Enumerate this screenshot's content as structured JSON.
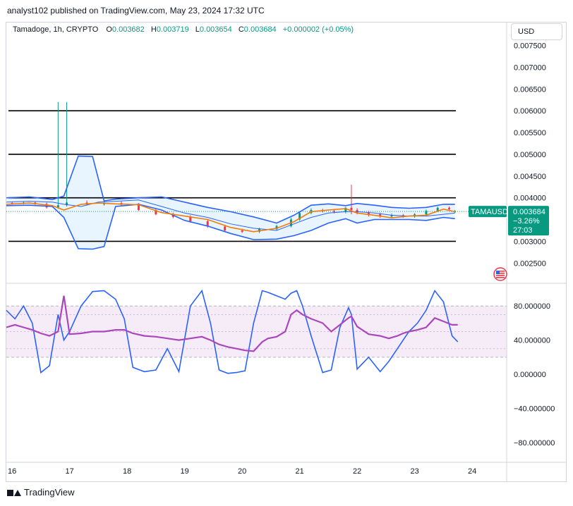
{
  "header": {
    "publish_line": "analyst102 published on TradingView.com, May 23, 2024 17:32 UTC"
  },
  "legend": {
    "symbol": "Tamadoge, 1h, CRYPTO",
    "open_key": "O",
    "open": "0.003682",
    "high_key": "H",
    "high": "0.003719",
    "low_key": "L",
    "low": "0.003654",
    "close_key": "C",
    "close": "0.003684",
    "change": "+0.000002 (+0.05%)"
  },
  "currency_button": "USD",
  "price_tag": {
    "ticker": "TAMAUSD",
    "price": "0.003684",
    "change_pct": "−3.26%",
    "countdown": "27:03"
  },
  "footer": {
    "brand": "TradingView"
  },
  "colors": {
    "up": "#089981",
    "down": "#f23645",
    "band": "#2962ff",
    "ma": "#f57c00",
    "stoch_k": "#2962ff",
    "stoch_d": "#ab47bc",
    "level": "#000000",
    "tag": "#089981"
  },
  "chart_data": [
    {
      "type": "line",
      "title": "",
      "x_ticks": [
        "16",
        "17",
        "18",
        "19",
        "20",
        "21",
        "22",
        "23",
        "24"
      ],
      "y_ticks": [
        "0.007500",
        "0.007000",
        "0.006500",
        "0.006000",
        "0.005500",
        "0.005000",
        "0.004500",
        "0.004000",
        "0.003500",
        "0.003000",
        "0.002500"
      ],
      "ylim": [
        0.0021,
        0.0078
      ],
      "xlim": [
        15.9,
        24.6
      ],
      "horizontal_levels": [
        0.006,
        0.005,
        0.004,
        0.003
      ],
      "series": [
        {
          "x": [
            15.9,
            16.3,
            16.7,
            16.9,
            17.2,
            17.5,
            17.8,
            18.2,
            18.6,
            19.0,
            19.4,
            19.8,
            20.2,
            20.6,
            20.9,
            21.2,
            21.5,
            21.8,
            22.0,
            22.3,
            22.6,
            22.9,
            23.2,
            23.5,
            23.7
          ],
          "y": [
            0.00385,
            0.00388,
            0.00382,
            0.00372,
            0.00385,
            0.00388,
            0.00386,
            0.00384,
            0.00366,
            0.00358,
            0.0035,
            0.00332,
            0.00322,
            0.0033,
            0.00345,
            0.00368,
            0.00372,
            0.00375,
            0.00365,
            0.0036,
            0.00354,
            0.00358,
            0.0036,
            0.00374,
            0.00368
          ]
        },
        {
          "x": [
            15.9,
            16.3,
            16.7,
            16.9,
            17.2,
            17.5,
            17.8,
            18.2,
            18.6,
            19.0,
            19.4,
            19.8,
            20.2,
            20.6,
            20.9,
            21.2,
            21.5,
            21.8,
            22.0,
            22.3,
            22.6,
            22.9,
            23.2,
            23.5,
            23.7
          ],
          "y": [
            0.0039,
            0.00392,
            0.0039,
            0.00385,
            0.0038,
            0.0039,
            0.00392,
            0.00395,
            0.0038,
            0.00365,
            0.00355,
            0.0034,
            0.0033,
            0.00325,
            0.0034,
            0.00355,
            0.00365,
            0.00368,
            0.00368,
            0.00365,
            0.0036,
            0.00358,
            0.00358,
            0.00362,
            0.00365
          ]
        },
        {
          "x": [
            15.9,
            16.3,
            16.7,
            16.9,
            17.15,
            17.4,
            17.6,
            17.8,
            18.2,
            18.6,
            19.0,
            19.4,
            19.8,
            20.2,
            20.6,
            20.9,
            21.2,
            21.5,
            21.8,
            22.0,
            22.3,
            22.6,
            22.9,
            23.2,
            23.5,
            23.7
          ],
          "y": [
            0.004,
            0.00402,
            0.00396,
            0.00404,
            0.00496,
            0.00495,
            0.00393,
            0.00397,
            0.004,
            0.00402,
            0.0039,
            0.00378,
            0.00368,
            0.00356,
            0.00342,
            0.0036,
            0.00383,
            0.00386,
            0.00382,
            0.00387,
            0.00383,
            0.00378,
            0.00376,
            0.00378,
            0.00385,
            0.00385
          ]
        },
        {
          "x": [
            15.9,
            16.3,
            16.7,
            16.9,
            17.15,
            17.4,
            17.6,
            17.8,
            18.2,
            18.6,
            19.0,
            19.4,
            19.8,
            20.2,
            20.6,
            20.9,
            21.2,
            21.5,
            21.8,
            22.0,
            22.3,
            22.6,
            22.9,
            23.2,
            23.5,
            23.7
          ],
          "y": [
            0.00382,
            0.00383,
            0.0038,
            0.00355,
            0.00283,
            0.00282,
            0.00288,
            0.0038,
            0.00385,
            0.00372,
            0.00348,
            0.00335,
            0.00318,
            0.00304,
            0.00305,
            0.00313,
            0.00325,
            0.00342,
            0.00352,
            0.00342,
            0.0035,
            0.0035,
            0.0035,
            0.00348,
            0.00355,
            0.00352
          ]
        }
      ],
      "candles": {
        "x": [
          16.0,
          16.2,
          16.4,
          16.6,
          16.8,
          16.95,
          17.3,
          17.6,
          17.9,
          18.2,
          18.5,
          18.8,
          19.1,
          19.4,
          19.7,
          20.0,
          20.3,
          20.6,
          20.85,
          21.0,
          21.2,
          21.4,
          21.6,
          21.8,
          21.9,
          22.0,
          22.2,
          22.4,
          22.6,
          22.8,
          23.0,
          23.2,
          23.4,
          23.6,
          23.7
        ],
        "open": [
          0.00388,
          0.00387,
          0.00389,
          0.00386,
          0.00378,
          0.00383,
          0.00389,
          0.00385,
          0.00388,
          0.00384,
          0.00372,
          0.00362,
          0.00356,
          0.00346,
          0.00334,
          0.00325,
          0.00322,
          0.00328,
          0.00335,
          0.0035,
          0.00365,
          0.00372,
          0.0037,
          0.00368,
          0.00377,
          0.00372,
          0.00366,
          0.00362,
          0.00357,
          0.0036,
          0.00357,
          0.00362,
          0.0037,
          0.00377,
          0.003682
        ],
        "close": [
          0.00387,
          0.00389,
          0.00386,
          0.00378,
          0.00383,
          0.00389,
          0.00385,
          0.00388,
          0.00384,
          0.00372,
          0.00362,
          0.00356,
          0.00346,
          0.00334,
          0.00325,
          0.00322,
          0.00328,
          0.00335,
          0.0035,
          0.00365,
          0.00372,
          0.0037,
          0.00368,
          0.00377,
          0.00372,
          0.00366,
          0.00362,
          0.00357,
          0.0036,
          0.00357,
          0.00362,
          0.0037,
          0.00377,
          0.00374,
          0.003684
        ],
        "high": [
          0.00391,
          0.00392,
          0.00391,
          0.00389,
          0.0062,
          0.0062,
          0.00394,
          0.00392,
          0.00392,
          0.00388,
          0.00376,
          0.00366,
          0.0036,
          0.0035,
          0.00338,
          0.00329,
          0.00331,
          0.00338,
          0.00354,
          0.00369,
          0.00376,
          0.00375,
          0.00373,
          0.00379,
          0.0043,
          0.00376,
          0.0037,
          0.00366,
          0.00364,
          0.00363,
          0.00365,
          0.00373,
          0.0038,
          0.0038,
          0.003719
        ],
        "low": [
          0.00384,
          0.00385,
          0.00384,
          0.00375,
          0.00375,
          0.0038,
          0.00382,
          0.00382,
          0.00381,
          0.0037,
          0.0036,
          0.00353,
          0.00343,
          0.00331,
          0.00322,
          0.00319,
          0.00319,
          0.00325,
          0.00332,
          0.00347,
          0.00362,
          0.00366,
          0.00364,
          0.00364,
          0.00362,
          0.00362,
          0.00357,
          0.00354,
          0.00353,
          0.00354,
          0.00354,
          0.0036,
          0.00367,
          0.00371,
          0.003654
        ]
      }
    },
    {
      "type": "line",
      "title": "",
      "y_ticks": [
        "80.000000",
        "40.000000",
        "0.000000",
        "−40.000000",
        "−80.000000"
      ],
      "ylim": [
        -100,
        105
      ],
      "band": [
        20,
        80
      ],
      "guide_lines": [
        70,
        50,
        30
      ],
      "series": [
        {
          "x": [
            15.9,
            16.05,
            16.2,
            16.35,
            16.5,
            16.65,
            16.8,
            16.9,
            17.0,
            17.2,
            17.4,
            17.6,
            17.8,
            17.95,
            18.1,
            18.3,
            18.5,
            18.7,
            18.9,
            19.1,
            19.3,
            19.45,
            19.6,
            19.75,
            19.9,
            20.05,
            20.2,
            20.35,
            20.45,
            20.6,
            20.75,
            20.85,
            20.95,
            21.05,
            21.2,
            21.4,
            21.55,
            21.7,
            21.85,
            21.9,
            22.0,
            22.2,
            22.4,
            22.55,
            22.7,
            22.8,
            22.9,
            23.05,
            23.2,
            23.35,
            23.5,
            23.65,
            23.75
          ],
          "y": [
            75,
            65,
            80,
            60,
            2,
            10,
            70,
            40,
            50,
            80,
            97,
            98,
            88,
            65,
            8,
            3,
            5,
            30,
            3,
            80,
            98,
            60,
            5,
            1,
            2,
            4,
            60,
            98,
            96,
            92,
            88,
            95,
            98,
            80,
            45,
            2,
            5,
            55,
            78,
            70,
            6,
            20,
            3,
            15,
            30,
            40,
            50,
            60,
            75,
            98,
            85,
            45,
            38
          ]
        },
        {
          "x": [
            15.9,
            16.05,
            16.2,
            16.35,
            16.5,
            16.65,
            16.8,
            16.9,
            17.0,
            17.2,
            17.4,
            17.6,
            17.8,
            17.95,
            18.1,
            18.3,
            18.5,
            18.7,
            18.9,
            19.1,
            19.3,
            19.45,
            19.6,
            19.75,
            19.9,
            20.05,
            20.2,
            20.35,
            20.45,
            20.6,
            20.75,
            20.85,
            20.95,
            21.05,
            21.2,
            21.4,
            21.55,
            21.7,
            21.85,
            21.9,
            22.0,
            22.2,
            22.4,
            22.55,
            22.7,
            22.8,
            22.9,
            23.05,
            23.2,
            23.35,
            23.5,
            23.65,
            23.75
          ],
          "y": [
            55,
            58,
            55,
            52,
            48,
            45,
            50,
            92,
            47,
            48,
            50,
            50,
            52,
            52,
            48,
            45,
            44,
            42,
            40,
            42,
            44,
            40,
            35,
            32,
            30,
            28,
            27,
            38,
            42,
            44,
            50,
            70,
            75,
            70,
            65,
            60,
            50,
            58,
            66,
            68,
            56,
            47,
            45,
            42,
            45,
            48,
            50,
            52,
            55,
            66,
            62,
            58,
            58
          ]
        }
      ]
    }
  ]
}
